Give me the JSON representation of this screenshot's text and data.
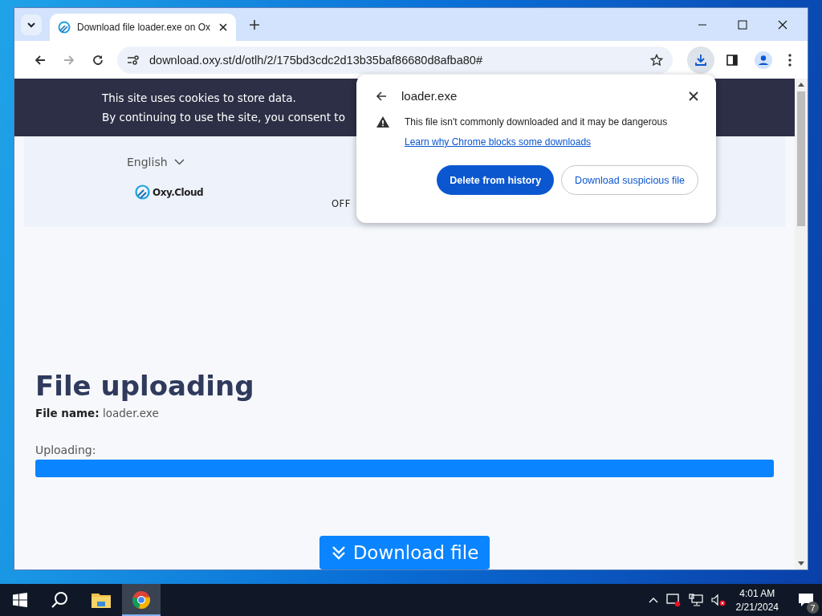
{
  "browser": {
    "tab_title": "Download file loader.exe on Ox",
    "url": "download.oxy.st/d/otlh/2/175bd3cdc2d13b35baf86680d8afba80#"
  },
  "page": {
    "cookie_banner": [
      "This site uses cookies to store data.",
      "By continuing to use the site, you consent to"
    ],
    "language": "English",
    "logo": "Oxy.Cloud",
    "nav_item": "OFF",
    "heading": "File uploading",
    "file_name": "**File name:** loader.exe",
    "progress_label": "Uploading:",
    "progress": {
      "level": 1
    },
    "download_button": "Download file"
  },
  "download_popup": {
    "file": "loader.exe",
    "warning": "This file isn't commonly downloaded and it may be dangerous",
    "link": "Learn why Chrome blocks some downloads",
    "buttons": [
      {
        "label": "Delete from history",
        "kind": "primary"
      },
      {
        "label": "Download suspicious file",
        "kind": "secondary"
      }
    ]
  },
  "taskbar": {
    "time": "4:01 AM",
    "date": "2/21/2024",
    "notifications": "7"
  }
}
